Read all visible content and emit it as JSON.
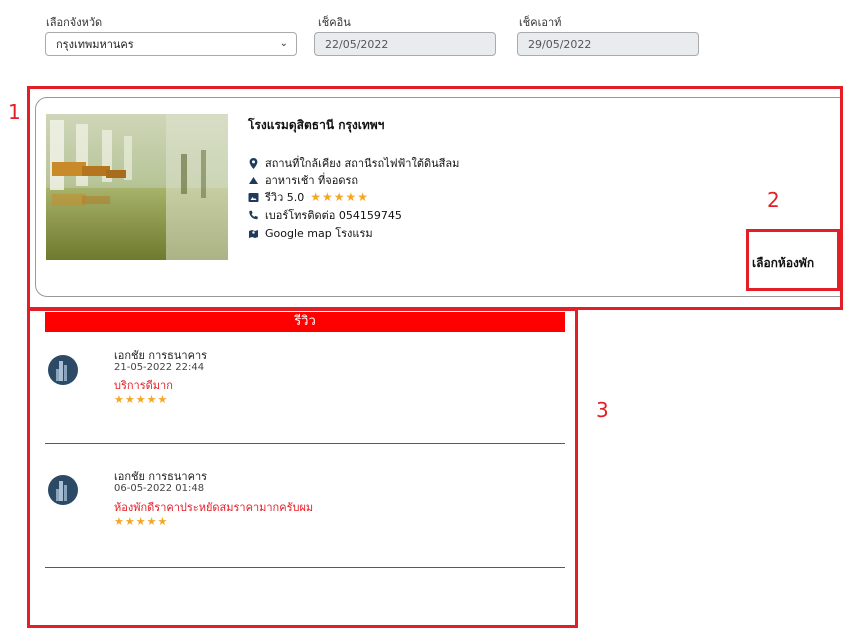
{
  "search": {
    "province_label": "เลือกจังหวัด",
    "province_value": "กรุงเทพมหานคร",
    "checkin_label": "เช็คอิน",
    "checkin_value": "22/05/2022",
    "checkout_label": "เช็คเอาท์",
    "checkout_value": "29/05/2022"
  },
  "annotations": [
    "1",
    "2",
    "3"
  ],
  "hotel": {
    "name": "โรงแรมดุสิตธานี กรุงเทพฯ",
    "nearby": "สถานที่ใกล้เคียง สถานีรถไฟฟ้าใต้ดินสีลม",
    "breakfast": "อาหารเช้า ที่จอดรถ",
    "review_label": "รีวิว 5.0",
    "review_stars": "★★★★★",
    "phone": "เบอร์โทรติดต่อ 054159745",
    "map": "Google map โรงแรม",
    "choose_room": "เลือกห้องพัก"
  },
  "reviews": {
    "header": "รีวิว",
    "items": [
      {
        "name": "เอกชัย การธนาคาร",
        "date": "21-05-2022 22:44",
        "text": "บริการดีมาก",
        "stars": "★★★★★"
      },
      {
        "name": "เอกชัย การธนาคาร",
        "date": "06-05-2022 01:48",
        "text": "ห้องพักดีราคาประหยัดสมราคามากครับผม",
        "stars": "★★★★★"
      }
    ]
  },
  "colors": {
    "accent": "#e41e26",
    "star": "#f5a623",
    "icon": "#1f3b5c"
  }
}
